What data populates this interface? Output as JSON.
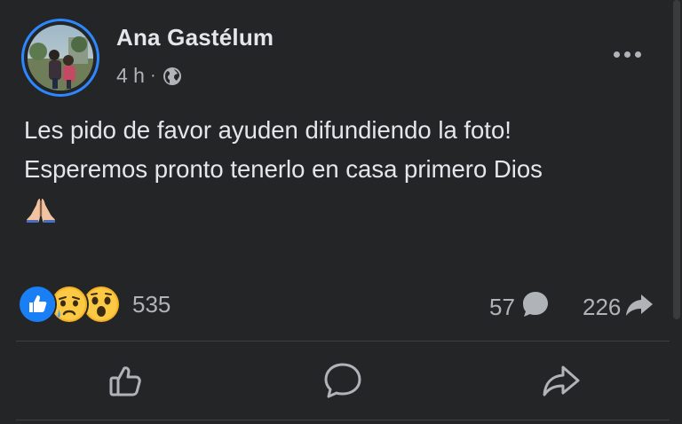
{
  "post": {
    "author": "Ana Gastélum",
    "time": "4 h",
    "separator": "·",
    "privacy_icon": "globe-icon",
    "text_lines": [
      "Les pido de favor ayuden difundiendo la foto!",
      "Esperemos pronto tenerlo en casa primero Dios"
    ],
    "emoji": "folded-hands-emoji",
    "more_icon": "more-options-icon"
  },
  "stats": {
    "reactions": [
      "like-reaction-icon",
      "sad-reaction-icon",
      "wow-reaction-icon"
    ],
    "reaction_count": "535",
    "comment_count": "57",
    "share_count": "226"
  },
  "actions": [
    "like-button",
    "comment-button",
    "share-button"
  ],
  "colors": {
    "background": "#242526",
    "text": "#e4e6eb",
    "secondary_text": "#b0b3b8",
    "accent_blue": "#2d88ff",
    "divider": "#3e4042"
  }
}
